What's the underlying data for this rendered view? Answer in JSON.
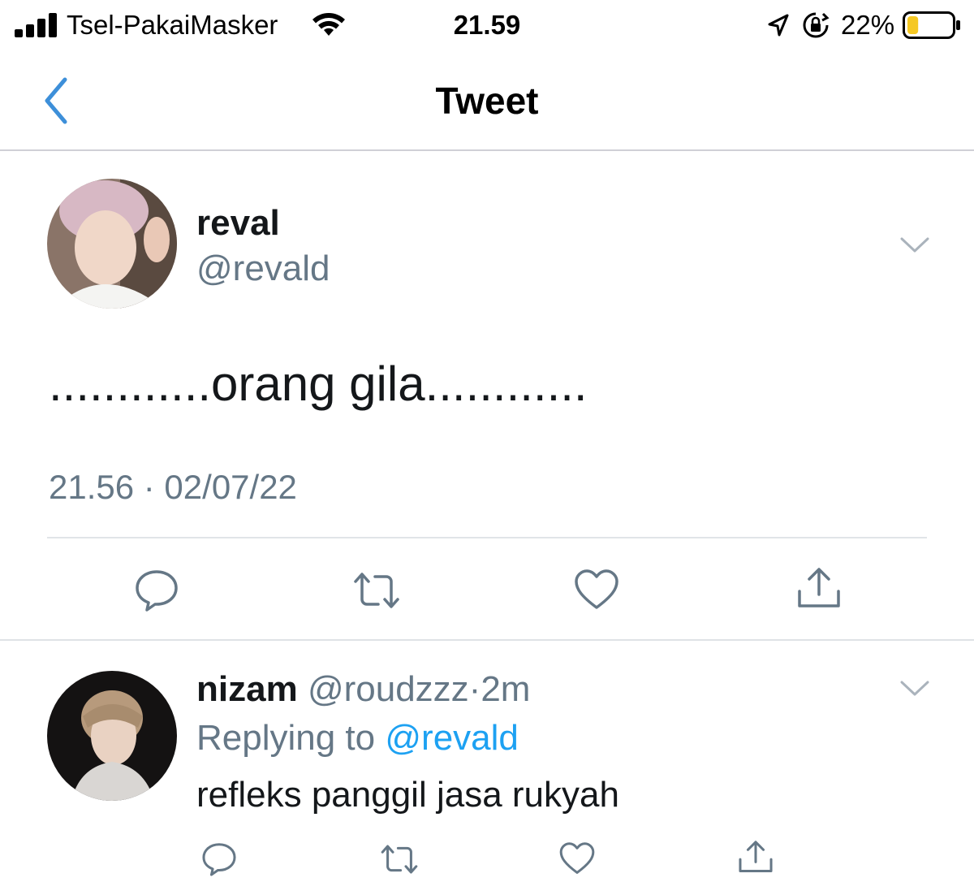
{
  "status_bar": {
    "carrier": "Tsel-PakaiMasker",
    "time": "21.59",
    "battery_percent": "22%",
    "battery_level": 0.22,
    "icons": [
      "signal-icon",
      "wifi-icon",
      "location-arrow-icon",
      "rotation-lock-icon",
      "battery-icon"
    ]
  },
  "nav": {
    "title": "Tweet",
    "back_icon": "chevron-left-icon"
  },
  "main_tweet": {
    "author_name": "reval",
    "author_handle": "@revald",
    "text": "............orang gila............",
    "timestamp": "21.56 · 02/07/22",
    "actions": [
      "reply-icon",
      "retweet-icon",
      "like-icon",
      "share-icon"
    ]
  },
  "reply": {
    "author_name": "nizam",
    "author_handle": "@roudzzz",
    "separator": "·",
    "age": "2m",
    "replying_to_prefix": "Replying to",
    "replying_to_handle": "@revald",
    "text": "refleks panggil jasa rukyah",
    "actions": [
      "reply-icon",
      "retweet-icon",
      "like-icon",
      "share-icon"
    ]
  },
  "colors": {
    "accent_blue": "#1da1f2",
    "ios_blue": "#3d8fd9",
    "secondary_text": "#657786",
    "icon_gray": "#657786",
    "battery_yellow": "#f5c823"
  }
}
